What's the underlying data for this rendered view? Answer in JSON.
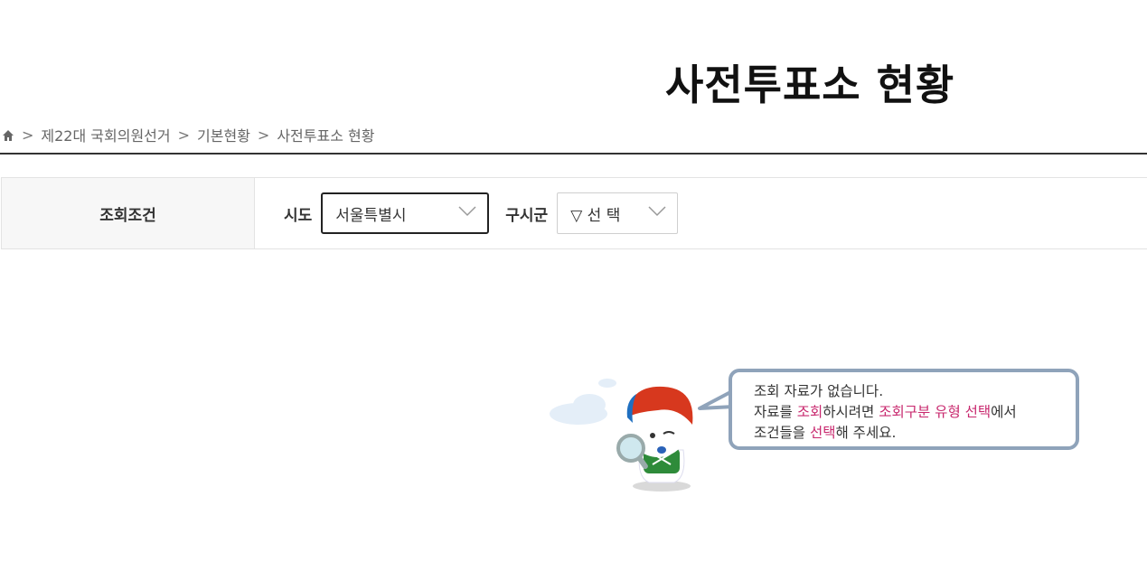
{
  "page": {
    "title": "사전투표소 현황"
  },
  "breadcrumb": {
    "items": [
      "제22대 국회의원선거",
      "기본현황",
      "사전투표소 현황"
    ],
    "separator": ">"
  },
  "filter": {
    "header": "조회조건",
    "sido": {
      "label": "시도",
      "value": "서울특별시"
    },
    "sigungu": {
      "label": "구시군",
      "value": "▽ 선 택"
    }
  },
  "empty_state": {
    "line1": "조회 자료가 없습니다.",
    "line2_a": "자료를 ",
    "line2_b": "조회",
    "line2_c": "하시려면 ",
    "line2_d": "조회구분 유형 선택",
    "line2_e": "에서",
    "line3_a": "조건들을 ",
    "line3_b": "선택",
    "line3_c": "해 주세요."
  },
  "colors": {
    "highlight": "#c8286e",
    "bubble_border": "#8fa3ba",
    "rule": "#333333"
  }
}
